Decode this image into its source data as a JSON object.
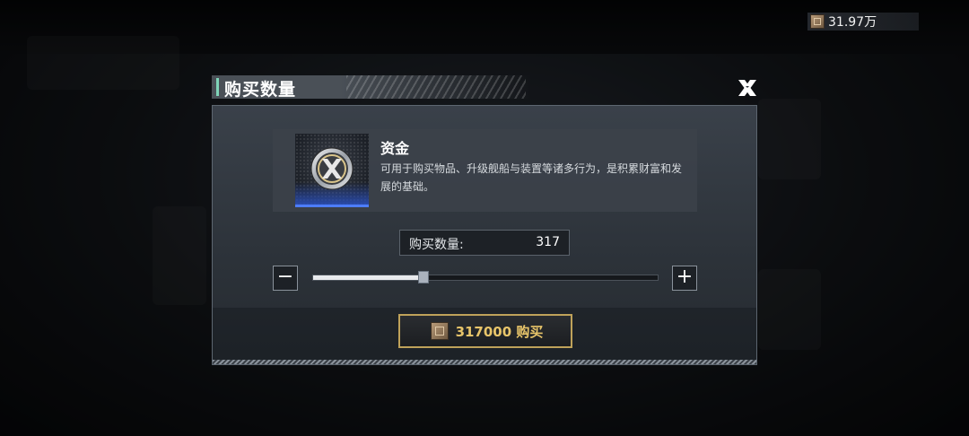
{
  "top_bar": {
    "currency_icon": "crate-icon",
    "currency_amount": "31.97万"
  },
  "dialog": {
    "title": "购买数量",
    "close_icon": "close-x-icon",
    "item": {
      "icon": "funds-coin-icon",
      "name": "资金",
      "description": "可用于购买物品、升级舰船与装置等诸多行为，是积累财富和发展的基础。"
    },
    "quantity": {
      "label": "购买数量:",
      "value": "317",
      "slider_fraction": 0.32
    },
    "minus_label": "−",
    "plus_label": "+",
    "buy_button": {
      "icon": "crate-icon",
      "label": "317000 购买"
    }
  },
  "colors": {
    "accent_teal": "#7fd4b8",
    "gold": "#e8c56a",
    "item_rarity_blue": "#2b4fb8"
  }
}
